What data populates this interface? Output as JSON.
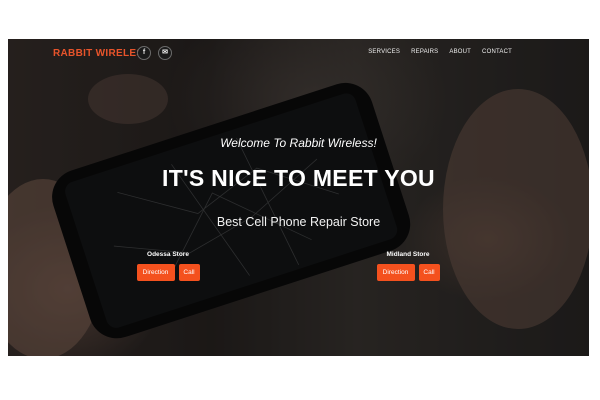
{
  "header": {
    "brand": "RABBIT WIRELESS",
    "social": [
      {
        "icon": "facebook-icon",
        "glyph": "f"
      },
      {
        "icon": "email-icon",
        "glyph": "✉"
      }
    ],
    "nav": [
      "SERVICES",
      "REPAIRS",
      "ABOUT",
      "CONTACT"
    ]
  },
  "hero": {
    "welcome": "Welcome To Rabbit Wireless!",
    "headline": "IT'S NICE TO MEET YOU",
    "subline": "Best Cell Phone Repair Store"
  },
  "stores": [
    {
      "name": "Odessa Store",
      "direction_label": "Direction",
      "call_label": "Call"
    },
    {
      "name": "Midland Store",
      "direction_label": "Direction",
      "call_label": "Call"
    }
  ],
  "colors": {
    "accent": "#f4511e",
    "brand": "#e8542b"
  }
}
